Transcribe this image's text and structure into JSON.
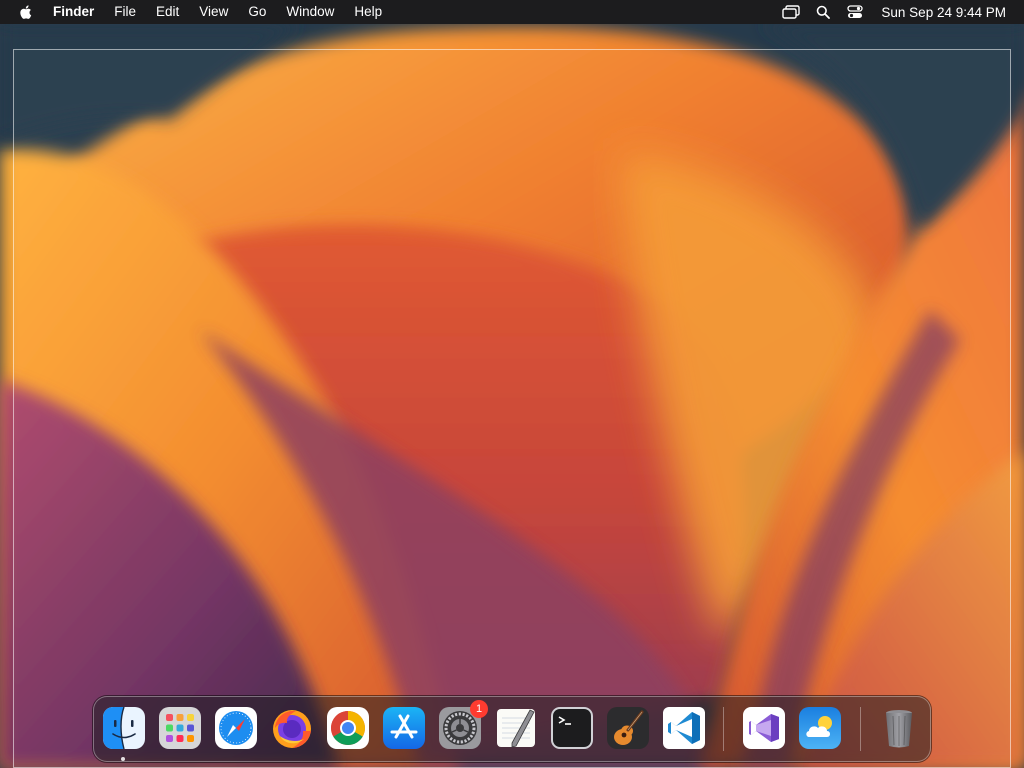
{
  "menubar": {
    "apple_icon": "apple-logo-icon",
    "app_name": "Finder",
    "menus": [
      "File",
      "Edit",
      "View",
      "Go",
      "Window",
      "Help"
    ],
    "status_icons": [
      "screen-mirroring-icon",
      "spotlight-search-icon",
      "control-center-icon"
    ],
    "clock": "Sun Sep 24  9:44 PM"
  },
  "dock": {
    "apps": [
      {
        "name": "Finder",
        "icon": "finder-icon",
        "running": true
      },
      {
        "name": "Launchpad",
        "icon": "launchpad-icon"
      },
      {
        "name": "Safari",
        "icon": "safari-icon"
      },
      {
        "name": "Firefox",
        "icon": "firefox-icon"
      },
      {
        "name": "Google Chrome",
        "icon": "chrome-icon"
      },
      {
        "name": "App Store",
        "icon": "app-store-icon"
      },
      {
        "name": "System Settings",
        "icon": "system-settings-icon",
        "badge": "1"
      },
      {
        "name": "TextEdit",
        "icon": "textedit-icon"
      },
      {
        "name": "Terminal",
        "icon": "terminal-icon"
      },
      {
        "name": "GarageBand",
        "icon": "garageband-icon"
      },
      {
        "name": "Visual Studio Code",
        "icon": "vscode-icon"
      },
      {
        "name": "Visual Studio",
        "icon": "visual-studio-icon"
      },
      {
        "name": "Weather",
        "icon": "weather-icon"
      },
      {
        "name": "Trash",
        "icon": "trash-icon"
      }
    ]
  },
  "colors": {
    "menubar_bg": "#1c1c1e",
    "wallpaper_dark": "#263a4b",
    "wallpaper_orange": "#f28a1e",
    "wallpaper_red": "#d94a2a",
    "wallpaper_purple": "#7a3a6a",
    "badge": "#ff3b30"
  }
}
